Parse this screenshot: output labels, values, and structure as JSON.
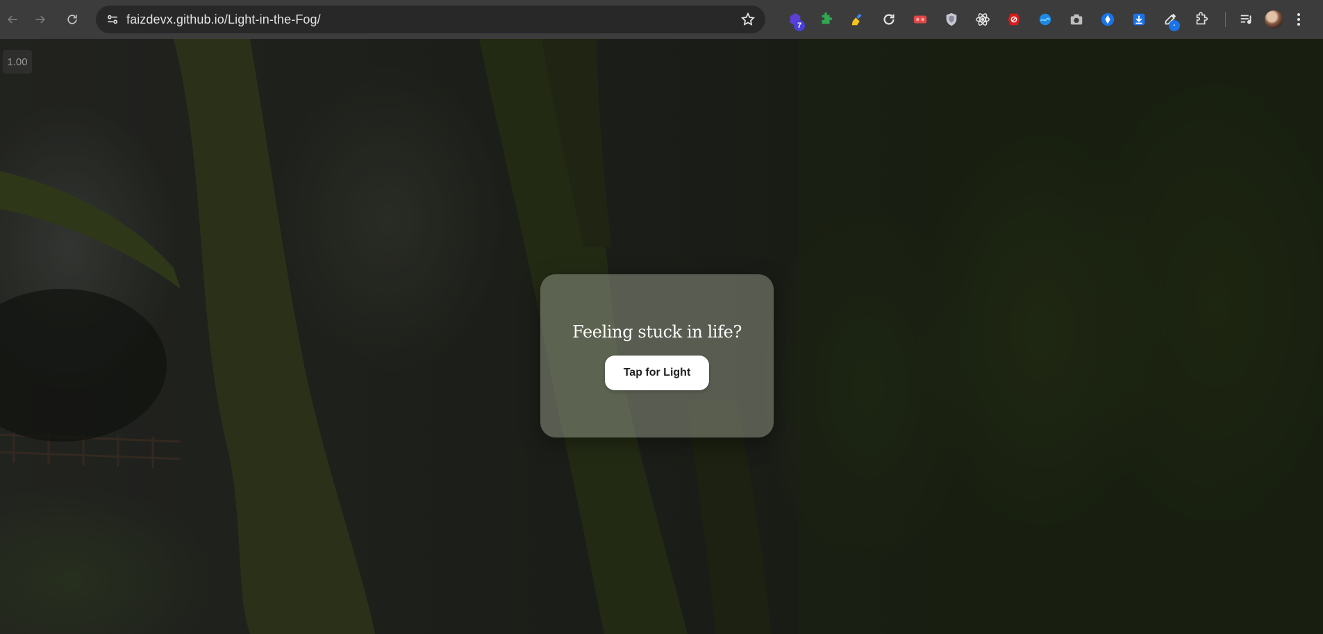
{
  "browser": {
    "url_host": "faizdevx.github.io",
    "url_path": "/Light-in-the-Fog/",
    "extensions": [
      {
        "icon": "hexagon-extension-icon",
        "badge": "7",
        "badge_color": "#4b3fd6"
      },
      {
        "icon": "puzzle-green-icon",
        "badge": null
      },
      {
        "icon": "broom-icon",
        "badge": null
      },
      {
        "icon": "reload-c-icon",
        "badge": null
      },
      {
        "icon": "vr-red-icon",
        "badge": null
      },
      {
        "icon": "shield-icon",
        "badge": null
      },
      {
        "icon": "atom-icon",
        "badge": null
      },
      {
        "icon": "red-blocker-icon",
        "badge": null
      },
      {
        "icon": "blue-wave-icon",
        "badge": null
      },
      {
        "icon": "camera-icon",
        "badge": null
      },
      {
        "icon": "blue-drop-icon",
        "badge": null
      },
      {
        "icon": "download-icon",
        "badge": null
      },
      {
        "icon": "eyedropper-icon",
        "badge": "·",
        "badge_color": "#1a73e8"
      },
      {
        "icon": "extensions-puzzle-icon",
        "badge": null
      }
    ]
  },
  "page": {
    "zoom_label": "1.00",
    "card_title": "Feeling stuck in life?",
    "card_button": "Tap for Light"
  },
  "colors": {
    "toolbar_bg": "#3c3c3c",
    "omnibox_bg": "#282828",
    "button_bg": "#ffffff"
  }
}
